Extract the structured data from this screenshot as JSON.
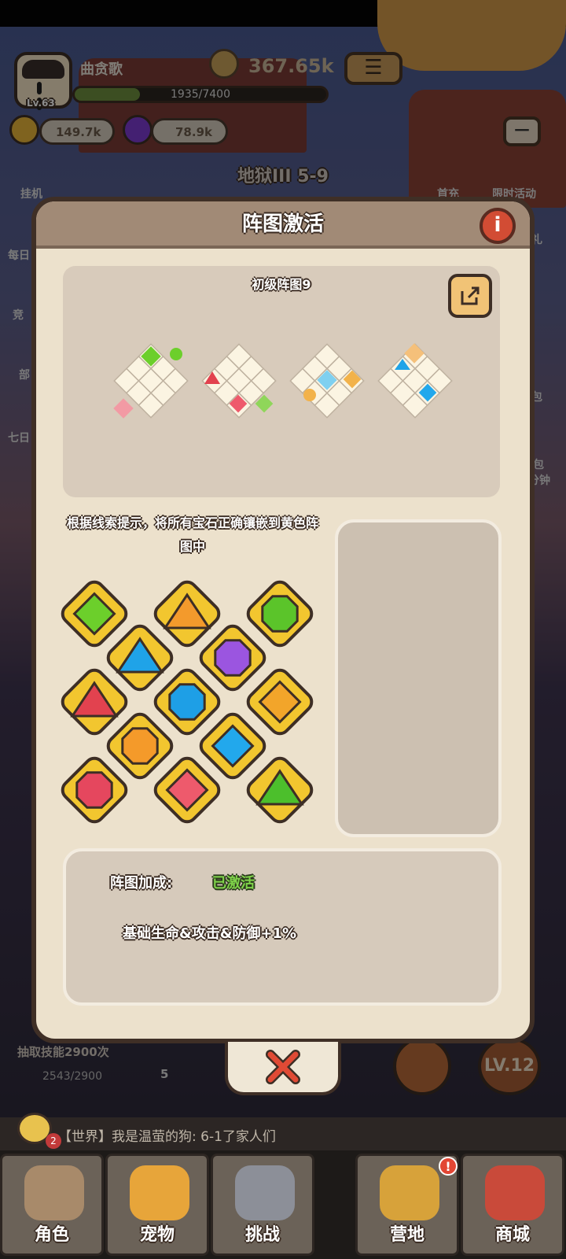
{
  "header": {
    "player_name": "曲贪歌",
    "level": "Lv.63",
    "xp_text": "1935/7400",
    "xp_progress": 0.26,
    "power": "367.65k",
    "gold": "149.7k",
    "gems": "78.9k",
    "stage": "地狱III 5-9"
  },
  "side_labels": {
    "idle": "挂机",
    "daily": "每日",
    "arena": "竞",
    "dept": "部",
    "seven_day": "七日",
    "first_charge": "首充",
    "limited_event": "限时活动",
    "gift": "礼",
    "pack": "包",
    "pack_min": "包",
    "minute": "分钟"
  },
  "modal": {
    "title": "阵图激活",
    "pattern_name": "初级阵图9",
    "hint": "根据线索提示，将所有宝石正确镶嵌到黄色阵图中",
    "bonus_label": "阵图加成:",
    "bonus_status": "已激活",
    "bonus_effect": "基础生命&攻击&防御+1%"
  },
  "gem_palette": [
    {
      "shape": "diamond",
      "color": "#6ccf2b"
    },
    {
      "shape": "triangle",
      "color": "#f39a2c"
    },
    {
      "shape": "octagon",
      "color": "#5bc42a"
    },
    {
      "shape": "triangle",
      "color": "#1fa3e8"
    },
    {
      "shape": "octagon",
      "color": "#9b55e0"
    },
    {
      "shape": "triangle",
      "color": "#e2424f"
    },
    {
      "shape": "octagon",
      "color": "#1e9fe6"
    },
    {
      "shape": "diamond",
      "color": "#f2a52a"
    },
    {
      "shape": "octagon",
      "color": "#f49a2a"
    },
    {
      "shape": "diamond",
      "color": "#22a8ec"
    },
    {
      "shape": "octagon",
      "color": "#e5475e"
    },
    {
      "shape": "diamond",
      "color": "#ee5a6c"
    },
    {
      "shape": "triangle",
      "color": "#4cbf2c"
    }
  ],
  "bottom": {
    "skill_text": "抽取技能2900次",
    "skill_count": "2543/2900",
    "skill_extra": "5",
    "level_btn": "LV.12",
    "chat_badge": "2",
    "chat_text": "【世界】我是温萤的狗: 6-1了家人们"
  },
  "nav": [
    {
      "label": "角色",
      "color": "#a88a6a"
    },
    {
      "label": "宠物",
      "color": "#e7a53a"
    },
    {
      "label": "挑战",
      "color": "#8c8f98"
    },
    {
      "label": "营地",
      "color": "#d7a23a"
    },
    {
      "label": "商城",
      "color": "#c94a3a"
    }
  ],
  "nav_badge": "!",
  "colors": {
    "modal_bg": "#ece1cc",
    "header_bar": "#a18a76",
    "accent_green": "#7fd34a"
  }
}
